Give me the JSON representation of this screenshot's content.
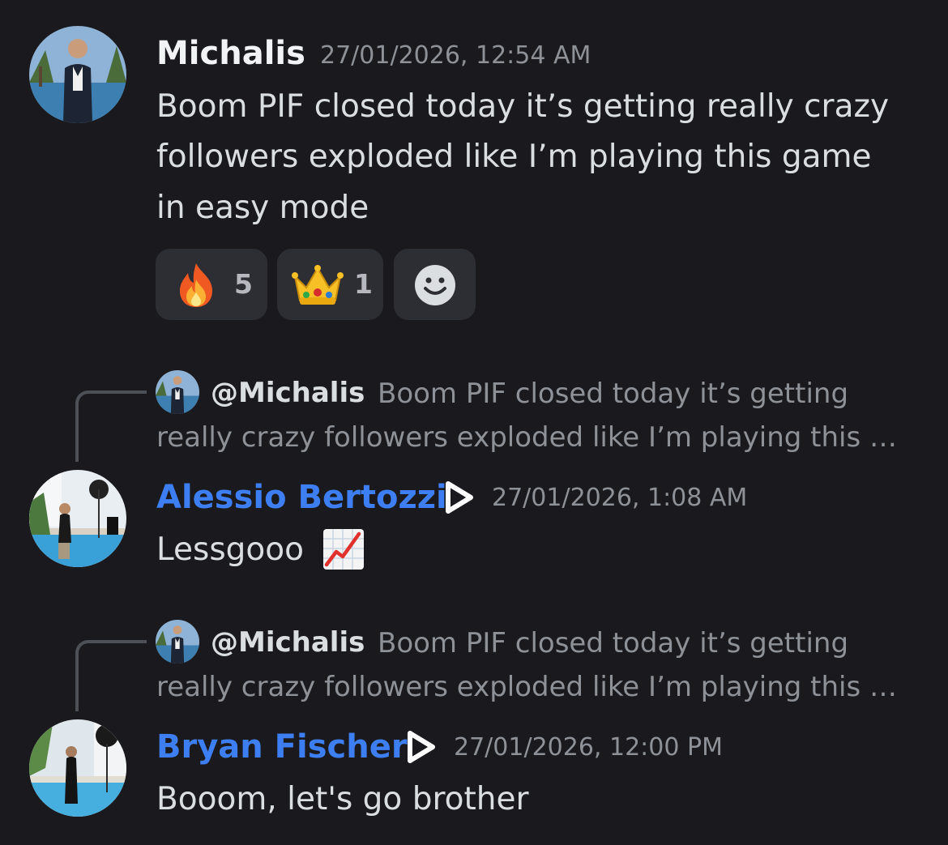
{
  "messages": [
    {
      "author": "Michalis",
      "timestamp": "27/01/2026, 12:54 AM",
      "lines": [
        "Boom PIF closed today it’s getting really crazy",
        "followers exploded like I’m playing this game",
        "in easy mode"
      ],
      "reactions": [
        {
          "emoji": "fire",
          "count": "5"
        },
        {
          "emoji": "crown",
          "count": "1"
        }
      ]
    },
    {
      "reply_to": {
        "author": "@Michalis",
        "line1": "Boom PIF closed today it’s getting",
        "line2": "really crazy followers exploded like I’m playing this …"
      },
      "author": "Alessio Bertozzi",
      "timestamp": "27/01/2026, 1:08 AM",
      "text": "Lessgooo"
    },
    {
      "reply_to": {
        "author": "@Michalis",
        "line1": "Boom PIF closed today it’s getting",
        "line2": "really crazy followers exploded like I’m playing this …"
      },
      "author": "Bryan Fischer",
      "timestamp": "27/01/2026, 12:00 PM",
      "text": "Booom, let's go brother"
    }
  ],
  "colors": {
    "background": "#1a1a1e",
    "member_name": "#3d7ff2",
    "reaction_bg": "#2d2e33",
    "muted_text": "#8e9198"
  }
}
